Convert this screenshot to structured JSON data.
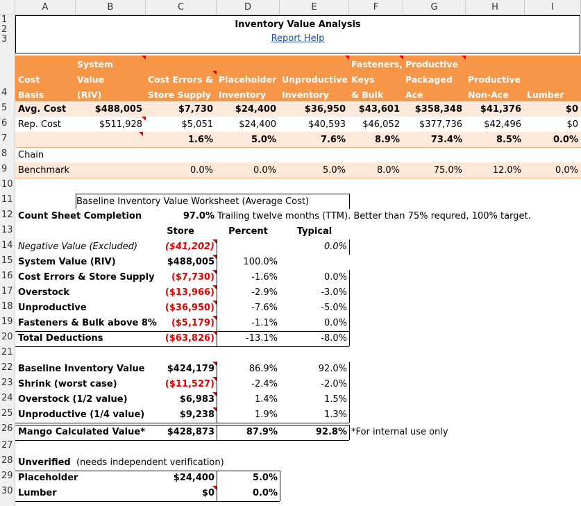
{
  "columns": [
    "A",
    "B",
    "C",
    "D",
    "E",
    "F",
    "G",
    "H",
    "I"
  ],
  "rows": [
    "1",
    "2",
    "3",
    "4",
    "5",
    "6",
    "7",
    "8",
    "9",
    "10",
    "11",
    "12",
    "13",
    "14",
    "15",
    "16",
    "17",
    "18",
    "19",
    "20",
    "21",
    "22",
    "23",
    "24",
    "25",
    "26",
    "27",
    "28",
    "29",
    "30"
  ],
  "title": "Inventory Value Analysis",
  "help_link": "Report Help",
  "header": {
    "cost_basis": [
      "Cost",
      "Basis"
    ],
    "riv": [
      "System",
      "Value",
      "(RIV)"
    ],
    "cost_errors": [
      "Cost Errors &",
      "Store Supply"
    ],
    "placeholder": [
      "Placeholder",
      "Inventory"
    ],
    "unproductive": [
      "Unproductive",
      "Inventory"
    ],
    "fasteners": [
      "Fasteners,",
      "Keys",
      "& Bulk"
    ],
    "prod_packaged": [
      "Productive",
      "Packaged",
      "Ace"
    ],
    "prod_nonace": [
      "Productive",
      "Non-Ace"
    ],
    "lumber": "Lumber",
    "colors": {
      "orange": "#f79646",
      "light": "#fde9d9"
    }
  },
  "row5": {
    "label": "Avg. Cost",
    "values": [
      "$488,005",
      "$7,730",
      "$24,400",
      "$36,950",
      "$43,601",
      "$358,348",
      "$41,376",
      "$0"
    ]
  },
  "row6": {
    "label": "Rep. Cost",
    "values": [
      "$511,928",
      "$5,051",
      "$24,400",
      "$40,593",
      "$46,052",
      "$377,736",
      "$42,496",
      "$0"
    ]
  },
  "row7": {
    "values": [
      "1.6%",
      "5.0%",
      "7.6%",
      "8.9%",
      "73.4%",
      "8.5%",
      "0.0%"
    ]
  },
  "row8": {
    "label": "Chain"
  },
  "row9": {
    "label": "Benchmark",
    "values": [
      "0.0%",
      "0.0%",
      "5.0%",
      "8.0%",
      "75.0%",
      "12.0%",
      "0.0%"
    ]
  },
  "worksheet": {
    "title": "Baseline Inventory Value Worksheet (Average Cost)",
    "count_label": "Count Sheet Completion",
    "count_value": "97.0%",
    "count_note": "Trailing twelve months (TTM). Better than 75% requred, 100% target.",
    "col_store": "Store",
    "col_percent": "Percent",
    "col_typical": "Typical",
    "rows": [
      {
        "label": "Negative Value (Excluded)",
        "store": "($41,202)",
        "percent": "",
        "typical": "0.0%"
      },
      {
        "label": "System Value (RIV)",
        "store": "$488,005",
        "percent": "100.0%",
        "typical": ""
      },
      {
        "label": "Cost Errors & Store Supply",
        "store": "($7,730)",
        "percent": "-1.6%",
        "typical": "0.0%"
      },
      {
        "label": "Overstock",
        "store": "($13,966)",
        "percent": "-2.9%",
        "typical": "-3.0%"
      },
      {
        "label": "Unproductive",
        "store": "($36,950)",
        "percent": "-7.6%",
        "typical": "-5.0%"
      },
      {
        "label": "Fasteners & Bulk above 8%",
        "store": "($5,179)",
        "percent": "-1.1%",
        "typical": "0.0%"
      },
      {
        "label": "Total Deductions",
        "store": "($63,826)",
        "percent": "-13.1%",
        "typical": "-8.0%"
      }
    ],
    "rows2": [
      {
        "label": "Baseline Inventory Value",
        "store": "$424,179",
        "percent": "86.9%",
        "typical": "92.0%"
      },
      {
        "label": "Shrink (worst case)",
        "store": "($11,527)",
        "percent": "-2.4%",
        "typical": "-2.0%"
      },
      {
        "label": "Overstock (1/2 value)",
        "store": "$6,983",
        "percent": "1.4%",
        "typical": "1.5%"
      },
      {
        "label": "Unproductive (1/4 value)",
        "store": "$9,238",
        "percent": "1.9%",
        "typical": "1.3%"
      }
    ],
    "mango": {
      "label": "Mango Calculated Value*",
      "store": "$428,873",
      "percent": "87.9%",
      "typical": "92.8%",
      "note": "*For internal use only"
    },
    "unverified": {
      "label": "Unverified",
      "note": "(needs independent verification)"
    },
    "placeholder": {
      "label": "Placeholder",
      "store": "$24,400",
      "percent": "5.0%"
    },
    "lumber": {
      "label": "Lumber",
      "store": "$0",
      "percent": "0.0%"
    }
  }
}
